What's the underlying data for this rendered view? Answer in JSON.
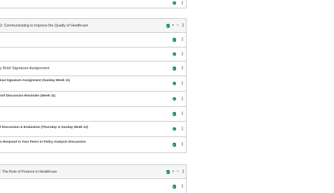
{
  "modules": [
    {
      "title": "2: Communicating to Improve the Quality of Healthcare",
      "items": [
        {
          "title": ""
        },
        {
          "title": ""
        },
        {
          "title": "y Brief Signature Assignment"
        },
        {
          "title": "inal Signature Assignment (Sunday Week 11)"
        },
        {
          "title": "rief Discussion Reminder (Week 11)"
        },
        {
          "title": ""
        },
        {
          "title": "f Discussion & Evaluation (Thursday & Sunday Week 12)"
        },
        {
          "title": "o Respond to Your Peers in Policy Analysis Discussion"
        }
      ]
    },
    {
      "title": ": The Role of Finance in Healthcare",
      "items": [
        {
          "title": ""
        }
      ]
    }
  ],
  "icons": {
    "published": "check-circle-icon",
    "caret": "caret-down-icon",
    "add": "plus-icon",
    "menu": "kebab-menu-icon"
  },
  "colors": {
    "published_green": "#0b874b",
    "border": "#c7cdd1",
    "header_bg": "#f5f5f5"
  }
}
